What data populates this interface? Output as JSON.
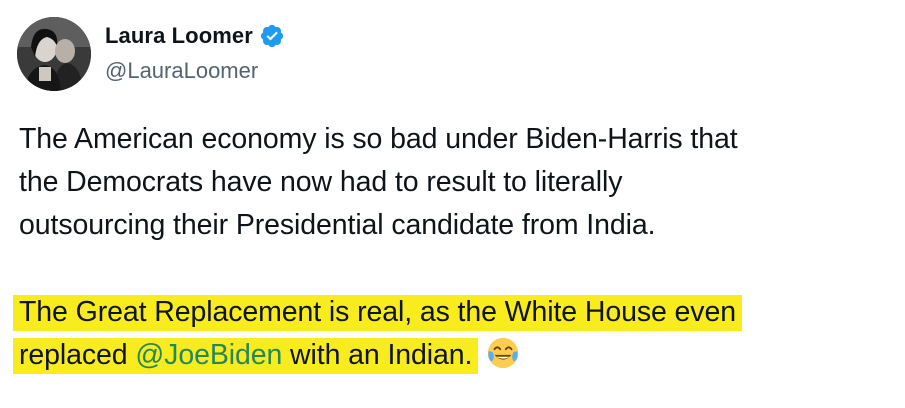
{
  "author": {
    "display_name": "Laura Loomer",
    "handle": "@LauraLoomer",
    "verified": true,
    "verified_color": "#1d9bf0"
  },
  "tweet": {
    "paragraph_1_lines": [
      "The American economy is so bad under Biden-Harris that",
      "the Democrats have now had to result to literally",
      "outsourcing their Presidential candidate from India."
    ],
    "paragraph_2": {
      "line_1": "The Great Replacement is real, as the White House even",
      "line_2_prefix": "replaced ",
      "mention": "@JoeBiden",
      "line_2_suffix": " with an Indian.",
      "emoji": "face-with-tears-of-joy"
    },
    "highlight_color": "#f8ec1f",
    "mention_color": "#26875a"
  },
  "icons": {
    "verified": "verified-badge-icon",
    "avatar": "profile-photo"
  }
}
